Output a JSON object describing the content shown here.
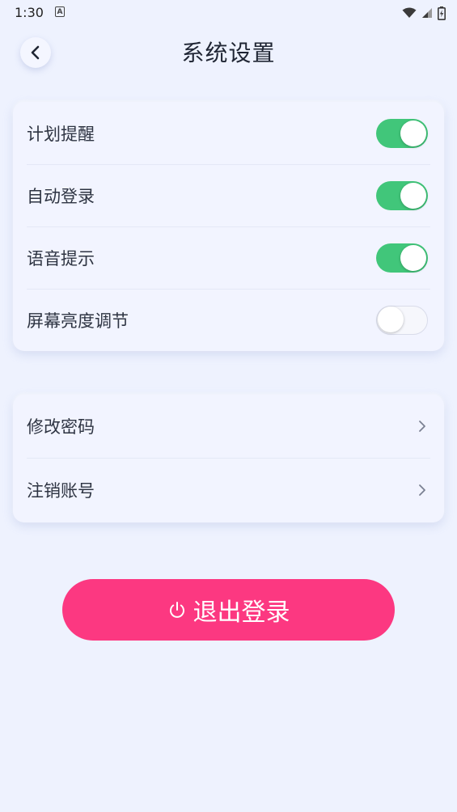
{
  "status_bar": {
    "time": "1:30",
    "notification_icon": "a-icon",
    "wifi_icon": "wifi-icon",
    "signal_icon": "signal-icon",
    "battery_icon": "battery-charging-icon"
  },
  "header": {
    "title": "系统设置",
    "back_icon": "chevron-left-icon"
  },
  "toggles": [
    {
      "label": "计划提醒",
      "on": true
    },
    {
      "label": "自动登录",
      "on": true
    },
    {
      "label": "语音提示",
      "on": true
    },
    {
      "label": "屏幕亮度调节",
      "on": false
    }
  ],
  "links": [
    {
      "label": "修改密码",
      "icon": "chevron-right-icon"
    },
    {
      "label": "注销账号",
      "icon": "chevron-right-icon"
    }
  ],
  "logout": {
    "label": "退出登录",
    "icon": "power-icon"
  },
  "colors": {
    "background": "#eef2fe",
    "toggle_on": "#41c67a",
    "logout_button": "#fc3881"
  }
}
